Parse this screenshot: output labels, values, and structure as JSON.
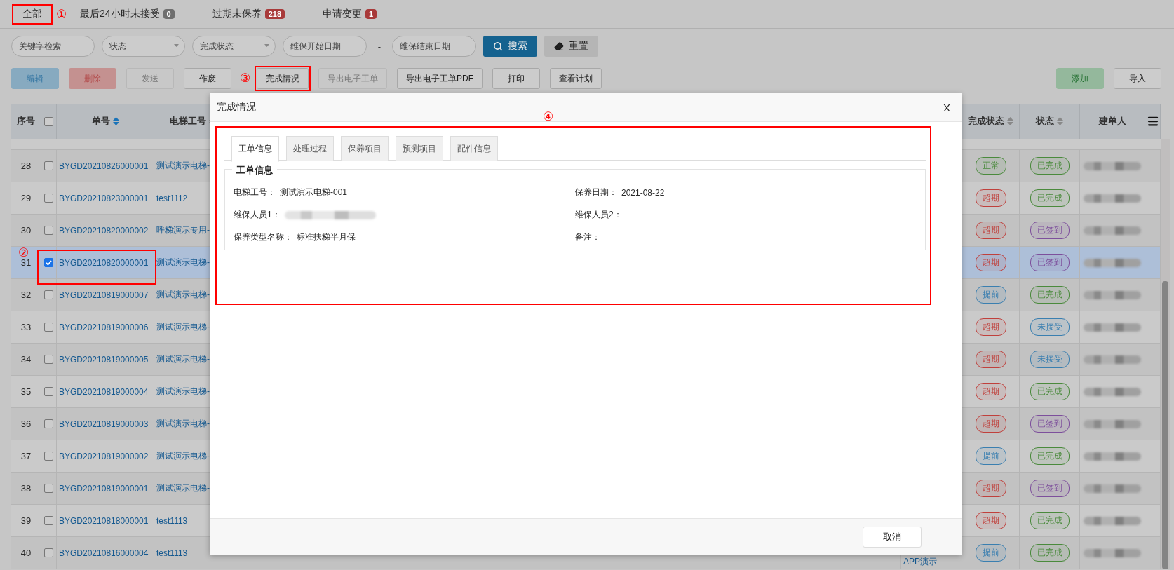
{
  "top_tabs": [
    {
      "label": "全部",
      "annotation": "①"
    },
    {
      "label": "最后24小时未接受",
      "count": "0",
      "color": "#6e6e6e"
    },
    {
      "label": "过期未保养",
      "count": "218",
      "color": "#a83a3a"
    },
    {
      "label": "申请变更",
      "count": "1",
      "color": "#a83a3a"
    }
  ],
  "filters": [
    {
      "kind": "text",
      "placeholder": "关键字检索"
    },
    {
      "kind": "select",
      "placeholder": "状态"
    },
    {
      "kind": "select",
      "placeholder": "完成状态"
    },
    {
      "kind": "date",
      "placeholder": "维保开始日期"
    },
    {
      "kind": "separator",
      "label": "-"
    },
    {
      "kind": "date",
      "placeholder": "维保结束日期"
    }
  ],
  "search_button": "搜索",
  "reset_button": "重置",
  "actions": [
    {
      "label": "编辑",
      "kind": "info",
      "disabled": true
    },
    {
      "label": "删除",
      "kind": "danger",
      "disabled": true
    },
    {
      "label": "发送",
      "kind": "default",
      "disabled": true
    },
    {
      "label": "作废",
      "kind": "default",
      "disabled": false
    },
    {
      "label": "完成情况",
      "kind": "default",
      "disabled": false,
      "annotation": "③"
    },
    {
      "label": "导出电子工单",
      "kind": "default",
      "disabled": true
    },
    {
      "label": "导出电子工单PDF",
      "kind": "default",
      "disabled": false
    },
    {
      "label": "打印",
      "kind": "default",
      "disabled": false
    },
    {
      "label": "查看计划",
      "kind": "default",
      "disabled": false
    }
  ],
  "right_actions": [
    {
      "label": "添加",
      "kind": "success",
      "disabled": false
    },
    {
      "label": "导入",
      "kind": "default",
      "disabled": false
    }
  ],
  "table": {
    "columns": [
      {
        "label": "序号",
        "kind": "text",
        "sortable": false
      },
      {
        "kind": "checkbox",
        "checked": false
      },
      {
        "label": "单号",
        "kind": "text",
        "sortable": true,
        "sorted": true
      },
      {
        "label": "电梯工号",
        "kind": "text",
        "sortable": true,
        "sorted": false
      },
      {
        "label": "完成状态",
        "kind": "text",
        "sortable": true,
        "sorted": false
      },
      {
        "label": "状态",
        "kind": "text",
        "sortable": true,
        "sorted": false
      },
      {
        "label": "建单人",
        "kind": "text",
        "sortable": false
      }
    ],
    "rows": [
      {
        "no": "28",
        "checked": false,
        "selected": false,
        "order_no": "BYGD20210826000001",
        "elevator_no": "测试演示电梯-",
        "completion": {
          "label": "正常",
          "color": "#4a8a3c"
        },
        "status": {
          "label": "已完成",
          "color": "#4a8a3c"
        }
      },
      {
        "no": "29",
        "checked": false,
        "selected": false,
        "order_no": "BYGD20210823000001",
        "elevator_no": "test1112",
        "completion": {
          "label": "超期",
          "color": "#c0403c"
        },
        "status": {
          "label": "已完成",
          "color": "#4a8a3c"
        }
      },
      {
        "no": "30",
        "checked": false,
        "selected": false,
        "order_no": "BYGD20210820000002",
        "elevator_no": "呼梯演示专用-",
        "completion": {
          "label": "超期",
          "color": "#c0403c"
        },
        "status": {
          "label": "已签到",
          "color": "#7d4f9c"
        }
      },
      {
        "no": "31",
        "checked": true,
        "selected": true,
        "order_no": "BYGD20210820000001",
        "elevator_no": "测试演示电梯-",
        "completion": {
          "label": "超期",
          "color": "#c0403c"
        },
        "status": {
          "label": "已签到",
          "color": "#7d4f9c"
        },
        "annotation": "②"
      },
      {
        "no": "32",
        "checked": false,
        "selected": false,
        "order_no": "BYGD20210819000007",
        "elevator_no": "测试演示电梯-",
        "completion": {
          "label": "提前",
          "color": "#3a7fb0"
        },
        "status": {
          "label": "已完成",
          "color": "#4a8a3c"
        }
      },
      {
        "no": "33",
        "checked": false,
        "selected": false,
        "order_no": "BYGD20210819000006",
        "elevator_no": "测试演示电梯-",
        "completion": {
          "label": "超期",
          "color": "#c0403c"
        },
        "status": {
          "label": "未接受",
          "color": "#3a7fb0"
        }
      },
      {
        "no": "34",
        "checked": false,
        "selected": false,
        "order_no": "BYGD20210819000005",
        "elevator_no": "测试演示电梯-",
        "completion": {
          "label": "超期",
          "color": "#c0403c"
        },
        "status": {
          "label": "未接受",
          "color": "#3a7fb0"
        }
      },
      {
        "no": "35",
        "checked": false,
        "selected": false,
        "order_no": "BYGD20210819000004",
        "elevator_no": "测试演示电梯-",
        "completion": {
          "label": "超期",
          "color": "#c0403c"
        },
        "status": {
          "label": "已完成",
          "color": "#4a8a3c"
        }
      },
      {
        "no": "36",
        "checked": false,
        "selected": false,
        "order_no": "BYGD20210819000003",
        "elevator_no": "测试演示电梯-",
        "completion": {
          "label": "超期",
          "color": "#c0403c"
        },
        "status": {
          "label": "已签到",
          "color": "#7d4f9c"
        }
      },
      {
        "no": "37",
        "checked": false,
        "selected": false,
        "order_no": "BYGD20210819000002",
        "elevator_no": "测试演示电梯-",
        "completion": {
          "label": "提前",
          "color": "#3a7fb0"
        },
        "status": {
          "label": "已完成",
          "color": "#4a8a3c"
        }
      },
      {
        "no": "38",
        "checked": false,
        "selected": false,
        "order_no": "BYGD20210819000001",
        "elevator_no": "测试演示电梯-",
        "completion": {
          "label": "超期",
          "color": "#c0403c"
        },
        "status": {
          "label": "已签到",
          "color": "#7d4f9c"
        }
      },
      {
        "no": "39",
        "checked": false,
        "selected": false,
        "order_no": "BYGD20210818000001",
        "elevator_no": "test1113",
        "completion": {
          "label": "超期",
          "color": "#c0403c"
        },
        "status": {
          "label": "已完成",
          "color": "#4a8a3c"
        }
      },
      {
        "no": "40",
        "checked": false,
        "selected": false,
        "order_no": "BYGD20210816000004",
        "elevator_no": "test1113",
        "column_5": "APP演示",
        "completion": {
          "label": "提前",
          "color": "#3a7fb0"
        },
        "status": {
          "label": "已完成",
          "color": "#4a8a3c"
        }
      }
    ]
  },
  "modal": {
    "title": "完成情况",
    "close": "X",
    "annotation": "④",
    "tabs": [
      {
        "label": "工单信息",
        "selected": true
      },
      {
        "label": "处理过程",
        "selected": false
      },
      {
        "label": "保养项目",
        "selected": false
      },
      {
        "label": "预测项目",
        "selected": false
      },
      {
        "label": "配件信息",
        "selected": false
      }
    ],
    "section": "工单信息",
    "fields": [
      {
        "label": "电梯工号：",
        "value": "测试演示电梯-001"
      },
      {
        "label": "保养日期：",
        "value": "2021-08-22"
      },
      {
        "label": "维保人员1：",
        "redacted": true
      },
      {
        "label": "维保人员2："
      },
      {
        "label": "保养类型名称：",
        "value": "标准扶梯半月保"
      },
      {
        "label": "备注："
      }
    ],
    "cancel_button": "取消"
  }
}
